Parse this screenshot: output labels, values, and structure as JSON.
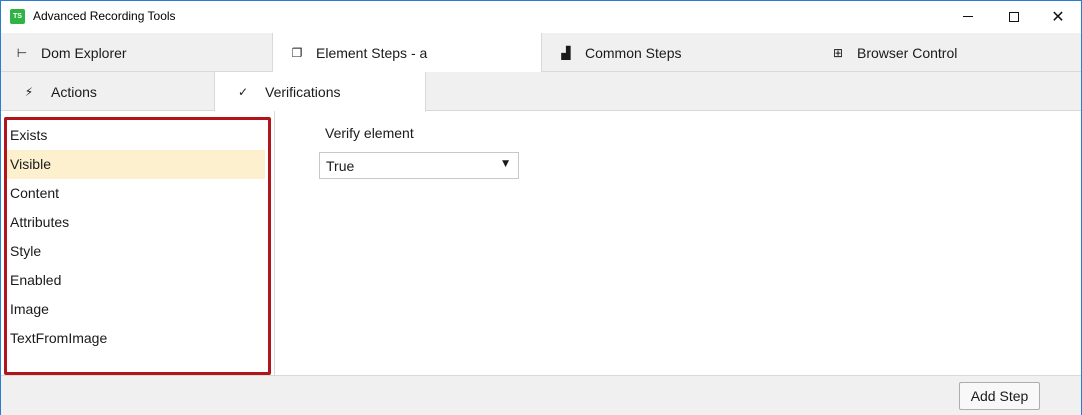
{
  "window": {
    "title": "Advanced Recording Tools",
    "app_icon_text": "TS",
    "controls": {
      "minimize_icon": "minimize-icon",
      "maximize_icon": "maximize-icon",
      "close_icon": "close-icon",
      "close_glyph": "✕"
    }
  },
  "top_tabs": [
    {
      "label": "Dom Explorer",
      "icon": "tree-icon",
      "glyph": "⊢",
      "active": false
    },
    {
      "label": "Element Steps - a",
      "icon": "stack-icon",
      "glyph": "❐",
      "active": true
    },
    {
      "label": "Common Steps",
      "icon": "steps-icon",
      "glyph": "▟",
      "active": false
    },
    {
      "label": "Browser Control",
      "icon": "browser-icon",
      "glyph": "⊞",
      "active": false
    }
  ],
  "sub_tabs": [
    {
      "label": "Actions",
      "icon": "lightning-icon",
      "glyph": "⚡",
      "active": false
    },
    {
      "label": "Verifications",
      "icon": "checkmark-icon",
      "glyph": "✓",
      "active": true
    }
  ],
  "verifications": {
    "items": [
      "Exists",
      "Visible",
      "Content",
      "Attributes",
      "Style",
      "Enabled",
      "Image",
      "TextFromImage"
    ],
    "selected": "Visible"
  },
  "verify_element": {
    "label": "Verify element",
    "value": "True",
    "arrow": "▼"
  },
  "footer": {
    "add_step_label": "Add Step"
  },
  "colors": {
    "selection": "#fdf0cf",
    "highlight_frame": "#b1141a",
    "app_icon": "#2fb344",
    "window_border": "#2b7bd6"
  }
}
